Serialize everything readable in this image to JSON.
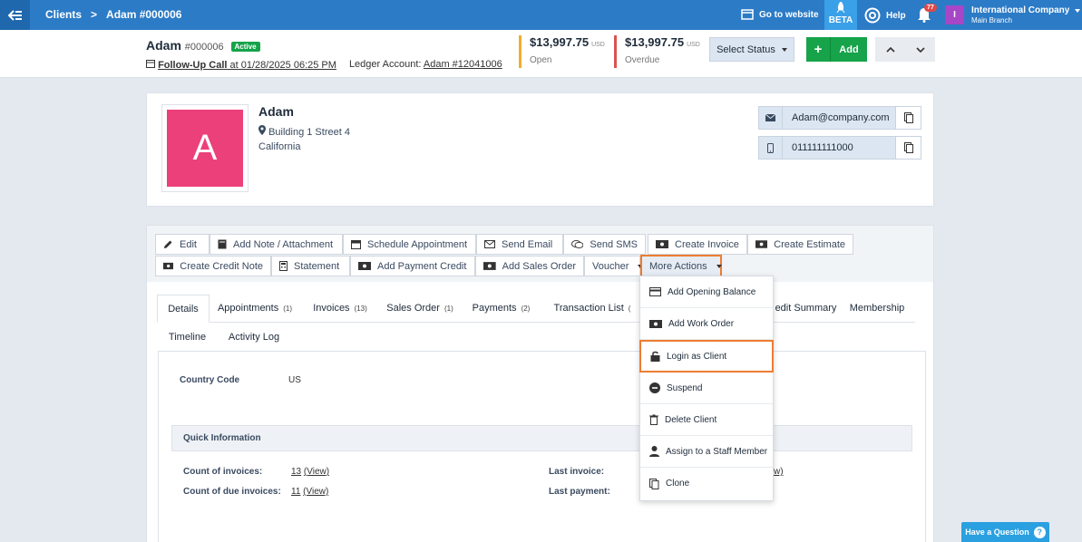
{
  "topbar": {
    "crumb_root": "Clients",
    "crumb_sep": ">",
    "crumb_current": "Adam #000006",
    "go_website": "Go to website",
    "beta": "BETA",
    "help": "Help",
    "notif_count": "77",
    "avatar_letter": "I",
    "company": "International Company",
    "branch": "Main Branch"
  },
  "header": {
    "name": "Adam",
    "number": "#000006",
    "status": "Active",
    "followup_label": "Follow-Up Call",
    "followup_date": " at 01/28/2025 06:25 PM",
    "ledger_label": "Ledger Account: ",
    "ledger_value": "Adam #12041006",
    "open_amount": "$13,997.75",
    "open_currency": "USD",
    "open_label": "Open",
    "overdue_amount": "$13,997.75",
    "overdue_currency": "USD",
    "overdue_label": "Overdue",
    "select_status": "Select Status",
    "add": "Add",
    "colors": {
      "open": "#f0ad2e",
      "overdue": "#d9534f",
      "add": "#16a34a"
    }
  },
  "profile": {
    "avatar_letter": "A",
    "name": "Adam",
    "address1": "Building 1 Street 4",
    "address2": "California",
    "email": "Adam@company.com",
    "phone": "011111111000",
    "avatar_color": "#ec407a"
  },
  "toolbar": {
    "edit": "Edit",
    "add_note": "Add Note / Attachment",
    "schedule": "Schedule Appointment",
    "send_email": "Send Email",
    "send_sms": "Send SMS",
    "create_invoice": "Create Invoice",
    "create_estimate": "Create Estimate",
    "create_credit_note": "Create Credit Note",
    "statement": "Statement",
    "add_payment_credit": "Add Payment Credit",
    "add_sales_order": "Add Sales Order",
    "voucher": "Voucher",
    "more_actions": "More Actions"
  },
  "tabs": [
    {
      "label": "Details",
      "count": ""
    },
    {
      "label": "Appointments",
      "count": "(1)"
    },
    {
      "label": "Invoices",
      "count": "(13)"
    },
    {
      "label": "Sales Order",
      "count": "(1)"
    },
    {
      "label": "Payments",
      "count": "(2)"
    },
    {
      "label": "Transaction List",
      "count": "("
    },
    {
      "label": "edit Summary",
      "count": ""
    },
    {
      "label": "Membership",
      "count": ""
    },
    {
      "label": "Timeline",
      "count": ""
    },
    {
      "label": "Activity Log",
      "count": ""
    }
  ],
  "details": {
    "country_code_label": "Country Code",
    "country_code_value": "US",
    "quick_info": "Quick Information",
    "count_invoices_label": "Count of invoices:",
    "count_invoices_value": "13",
    "count_due_label": "Count of due invoices:",
    "count_due_value": "11",
    "view": "(View)",
    "last_invoice_label": "Last invoice:",
    "last_payment_label": "Last payment:",
    "partial_view": "w)"
  },
  "dropdown": [
    "Add Opening Balance",
    "Add Work Order",
    "Login as Client",
    "Suspend",
    "Delete Client",
    "Assign to a Staff Member",
    "Clone"
  ],
  "help_question": "Have a Question"
}
